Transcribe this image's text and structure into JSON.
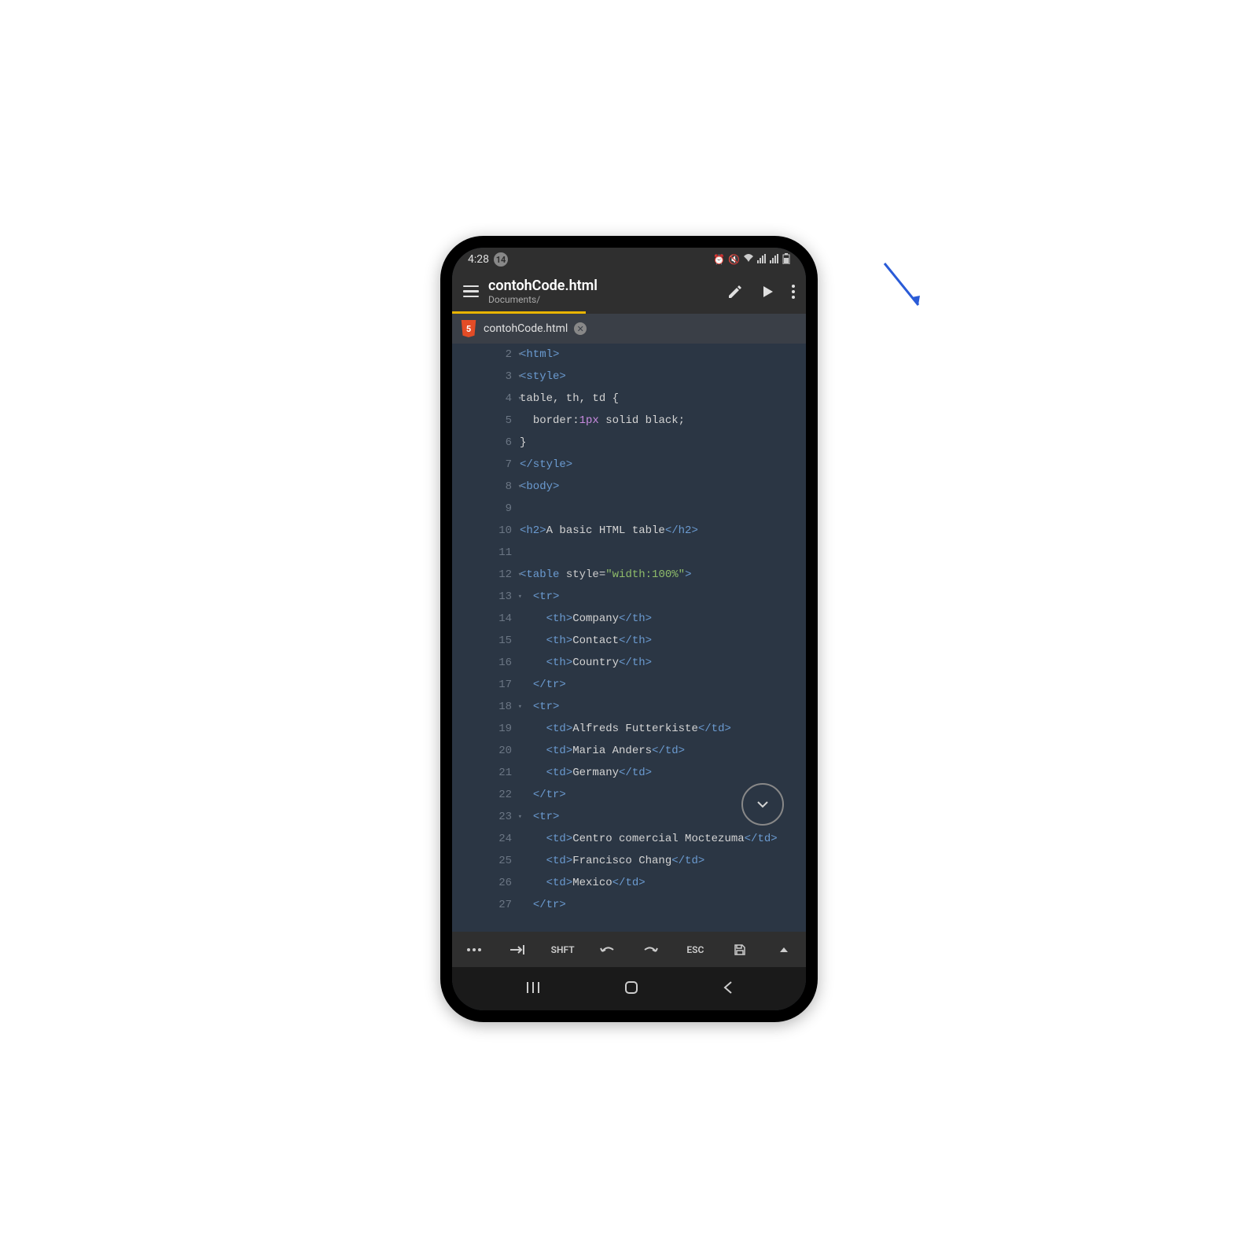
{
  "status": {
    "time": "4:28",
    "notif_count": "14"
  },
  "header": {
    "filename": "contohCode.html",
    "path": "Documents/"
  },
  "tab": {
    "name": "contohCode.html"
  },
  "toolbar": {
    "shift": "SHFT",
    "esc": "ESC"
  },
  "code": {
    "lines": [
      {
        "num": "2",
        "collapsible": true,
        "html": "<span class='tag'>&lt;html&gt;</span>"
      },
      {
        "num": "3",
        "collapsible": true,
        "html": "<span class='tag'>&lt;style&gt;</span>"
      },
      {
        "num": "4",
        "collapsible": true,
        "html": "<span class='text'>table, th, td {</span>"
      },
      {
        "num": "5",
        "collapsible": false,
        "html": "<span class='text'>  </span><span class='prop'>border:</span><span class='val'>1px</span><span class='text'> solid black;</span>"
      },
      {
        "num": "6",
        "collapsible": false,
        "html": "<span class='text'>}</span>"
      },
      {
        "num": "7",
        "collapsible": false,
        "html": "<span class='tag'>&lt;/style&gt;</span>"
      },
      {
        "num": "8",
        "collapsible": true,
        "html": "<span class='tag'>&lt;body&gt;</span>"
      },
      {
        "num": "9",
        "collapsible": false,
        "html": ""
      },
      {
        "num": "10",
        "collapsible": false,
        "html": "<span class='tag'>&lt;h2&gt;</span><span class='text'>A basic HTML table</span><span class='tag'>&lt;/h2&gt;</span>"
      },
      {
        "num": "11",
        "collapsible": false,
        "html": ""
      },
      {
        "num": "12",
        "collapsible": true,
        "html": "<span class='tag'>&lt;table</span> <span class='attr'>style</span><span class='punct'>=</span><span class='string'>\"width:100%\"</span><span class='tag'>&gt;</span>"
      },
      {
        "num": "13",
        "collapsible": true,
        "html": "  <span class='tag'>&lt;tr&gt;</span>"
      },
      {
        "num": "14",
        "collapsible": false,
        "html": "    <span class='tag'>&lt;th&gt;</span><span class='text'>Company</span><span class='tag'>&lt;/th&gt;</span>"
      },
      {
        "num": "15",
        "collapsible": false,
        "html": "    <span class='tag'>&lt;th&gt;</span><span class='text'>Contact</span><span class='tag'>&lt;/th&gt;</span>"
      },
      {
        "num": "16",
        "collapsible": false,
        "html": "    <span class='tag'>&lt;th&gt;</span><span class='text'>Country</span><span class='tag'>&lt;/th&gt;</span>"
      },
      {
        "num": "17",
        "collapsible": false,
        "html": "  <span class='tag'>&lt;/tr&gt;</span>"
      },
      {
        "num": "18",
        "collapsible": true,
        "html": "  <span class='tag'>&lt;tr&gt;</span>"
      },
      {
        "num": "19",
        "collapsible": false,
        "html": "    <span class='tag'>&lt;td&gt;</span><span class='text'>Alfreds Futterkiste</span><span class='tag'>&lt;/td&gt;</span>"
      },
      {
        "num": "20",
        "collapsible": false,
        "html": "    <span class='tag'>&lt;td&gt;</span><span class='text'>Maria Anders</span><span class='tag'>&lt;/td&gt;</span>"
      },
      {
        "num": "21",
        "collapsible": false,
        "html": "    <span class='tag'>&lt;td&gt;</span><span class='text'>Germany</span><span class='tag'>&lt;/td&gt;</span>"
      },
      {
        "num": "22",
        "collapsible": false,
        "html": "  <span class='tag'>&lt;/tr&gt;</span>"
      },
      {
        "num": "23",
        "collapsible": true,
        "html": "  <span class='tag'>&lt;tr&gt;</span>"
      },
      {
        "num": "24",
        "collapsible": false,
        "html": "    <span class='tag'>&lt;td&gt;</span><span class='text'>Centro comercial Moctezuma</span><span class='tag'>&lt;/td&gt;</span>"
      },
      {
        "num": "25",
        "collapsible": false,
        "html": "    <span class='tag'>&lt;td&gt;</span><span class='text'>Francisco Chang</span><span class='tag'>&lt;/td&gt;</span>"
      },
      {
        "num": "26",
        "collapsible": false,
        "html": "    <span class='tag'>&lt;td&gt;</span><span class='text'>Mexico</span><span class='tag'>&lt;/td&gt;</span>"
      },
      {
        "num": "27",
        "collapsible": false,
        "html": "  <span class='tag'>&lt;/tr&gt;</span>"
      }
    ]
  }
}
